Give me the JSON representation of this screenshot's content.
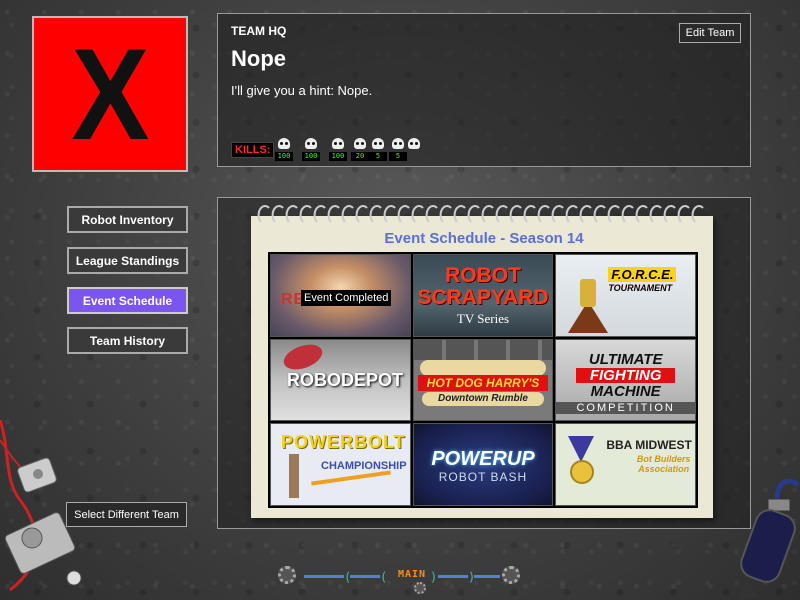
{
  "team": {
    "logo_glyph": "X",
    "hq_label": "TEAM HQ",
    "name": "Nope",
    "motto": "I'll give you a hint: Nope.",
    "edit_label": "Edit Team",
    "kills_label": "KILLS:",
    "kills": [
      "100",
      "100",
      "100",
      "20",
      "5",
      "5",
      ""
    ]
  },
  "nav": {
    "items": [
      {
        "label": "Robot Inventory"
      },
      {
        "label": "League Standings"
      },
      {
        "label": "Event Schedule",
        "active": true
      },
      {
        "label": "Team History"
      }
    ],
    "select_team_label": "Select Different Team"
  },
  "schedule": {
    "title": "Event Schedule - Season 14",
    "events": [
      {
        "logo_text": "RE          SION",
        "status": "Event Completed"
      },
      {
        "logo_line1": "ROBOT",
        "logo_line2": "SCRAPYARD",
        "logo_line3": "TV Series"
      },
      {
        "logo_line1": "F.O.R.C.E.",
        "logo_line2": "TOURNAMENT"
      },
      {
        "logo_line1": "ROBODEPOT"
      },
      {
        "logo_line1": "HOT DOG HARRY'S",
        "logo_line2": "Downtown Rumble"
      },
      {
        "logo_line1": "ULTIMATE",
        "logo_line2": "FIGHTING",
        "logo_line3": "MACHINE",
        "logo_line4": "COMPETITION"
      },
      {
        "logo_line1": "POWERBOLT",
        "logo_line2": "CHAMPIONSHIP"
      },
      {
        "logo_line1": "POWERUP",
        "logo_line2": "ROBOT BASH"
      },
      {
        "logo_line1": "BBA MIDWEST",
        "logo_line2": "Bot Builders Association"
      }
    ]
  },
  "bottom_bar": {
    "main_label": "MAIN"
  },
  "colors": {
    "accent_active": "#7a55ee",
    "logo_bg": "#ff0000",
    "schedule_title": "#5a6fd8",
    "kills_label": "#ff2a2a",
    "kill_count": "#33ff33"
  }
}
